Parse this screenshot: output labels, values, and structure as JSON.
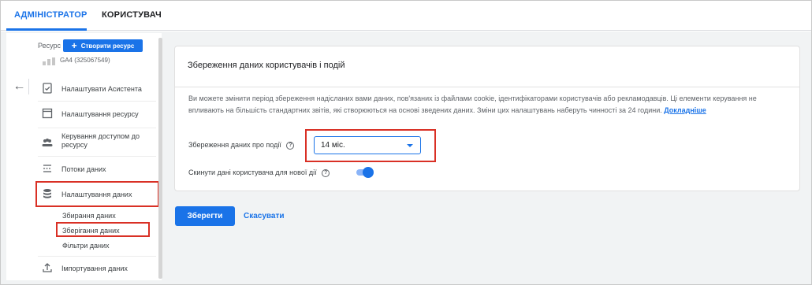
{
  "tabs": [
    {
      "label": "АДМІНІСТРАТОР",
      "active": true
    },
    {
      "label": "КОРИСТУВАЧ",
      "active": false
    }
  ],
  "sidebar": {
    "resource_label": "Ресурс",
    "create_button": "Створити ресурс",
    "property_name": "GA4 (325067549)",
    "items": [
      {
        "label": "Налаштувати Асистента",
        "icon": "checklist-icon"
      },
      {
        "label": "Налаштування ресурсу",
        "icon": "window-icon"
      },
      {
        "label": "Керування доступом до ресурсу",
        "icon": "people-icon"
      },
      {
        "label": "Потоки даних",
        "icon": "streams-icon"
      },
      {
        "label": "Налаштування даних",
        "icon": "database-icon"
      }
    ],
    "subitems": [
      {
        "label": "Збирання даних"
      },
      {
        "label": "Зберігання даних"
      },
      {
        "label": "Фільтри даних"
      }
    ],
    "import_item": {
      "label": "Імпортування даних",
      "icon": "upload-icon"
    }
  },
  "card": {
    "title": "Збереження даних користувачів і подій",
    "description": "Ви можете змінити період збереження надісланих вами даних, пов'язаних із файлами cookie, ідентифікаторами користувачів або рекламодавців. Ці елементи керування не впливають на більшість стандартних звітів, які створюються на основі зведених даних. Зміни цих налаштувань наберуть чинності за 24 години.",
    "learn_more": "Докладніше",
    "retention_label": "Збереження даних про події",
    "retention_value": "14 міс.",
    "reset_label": "Скинути дані користувача для нової дії",
    "reset_enabled": true
  },
  "actions": {
    "save": "Зберегти",
    "cancel": "Скасувати"
  },
  "colors": {
    "accent": "#1a73e8",
    "highlight": "#d93025"
  }
}
